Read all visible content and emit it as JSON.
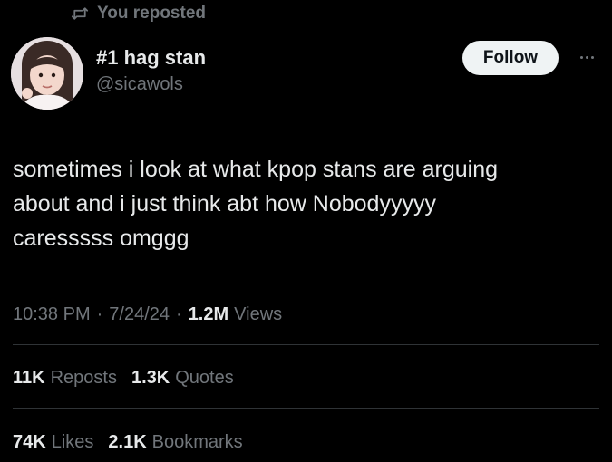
{
  "repost": {
    "icon": "repost-icon",
    "label": "You reposted"
  },
  "author": {
    "display_name": "#1 hag stan",
    "handle": "@sicawols",
    "avatar": "profile-photo"
  },
  "follow_label": "Follow",
  "more_icon": "more-horizontal-icon",
  "tweet": {
    "text": "sometimes i look at what kpop stans are arguing\nabout and i just think abt how Nobodyyyyy\ncaresssss omggg"
  },
  "meta": {
    "time": "10:38 PM",
    "separator": "·",
    "date": "7/24/24",
    "views_count": "1.2M",
    "views_label": "Views"
  },
  "stats": {
    "reposts": {
      "count": "11K",
      "label": "Reposts"
    },
    "quotes": {
      "count": "1.3K",
      "label": "Quotes"
    },
    "likes": {
      "count": "74K",
      "label": "Likes"
    },
    "bookmarks": {
      "count": "2.1K",
      "label": "Bookmarks"
    }
  },
  "colors": {
    "background": "#000000",
    "text_primary": "#e7e9ea",
    "text_secondary": "#71767b",
    "follow_bg": "#eff3f4",
    "divider": "#2f3336"
  }
}
